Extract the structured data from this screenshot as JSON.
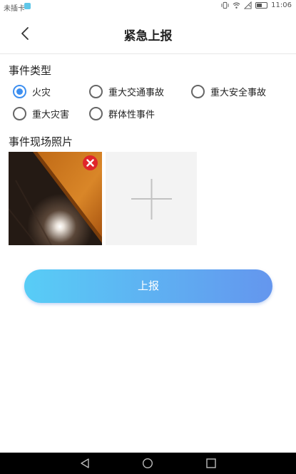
{
  "status_bar": {
    "carrier": "未插卡",
    "time": "11:06",
    "icons": [
      "sim-badge-icon",
      "vibrate-icon",
      "wifi-icon",
      "no-signal-icon",
      "battery-icon"
    ]
  },
  "header": {
    "title": "紧急上报",
    "back_icon": "chevron-left-icon"
  },
  "event_type": {
    "label": "事件类型",
    "options": [
      "火灾",
      "重大交通事故",
      "重大安全事故",
      "重大灾害",
      "群体性事件"
    ],
    "selected": "火灾"
  },
  "photos": {
    "label": "事件现场照片",
    "remove_icon": "close-icon",
    "add_icon": "plus-icon"
  },
  "submit": {
    "label": "上报"
  },
  "system_nav": {
    "icons": [
      "back-triangle-icon",
      "home-circle-icon",
      "recents-square-icon"
    ]
  },
  "colors": {
    "accent": "#3d8ff0",
    "button_gradient_start": "#58cdf6",
    "button_gradient_end": "#6496ee",
    "remove_badge": "#e0262b"
  }
}
